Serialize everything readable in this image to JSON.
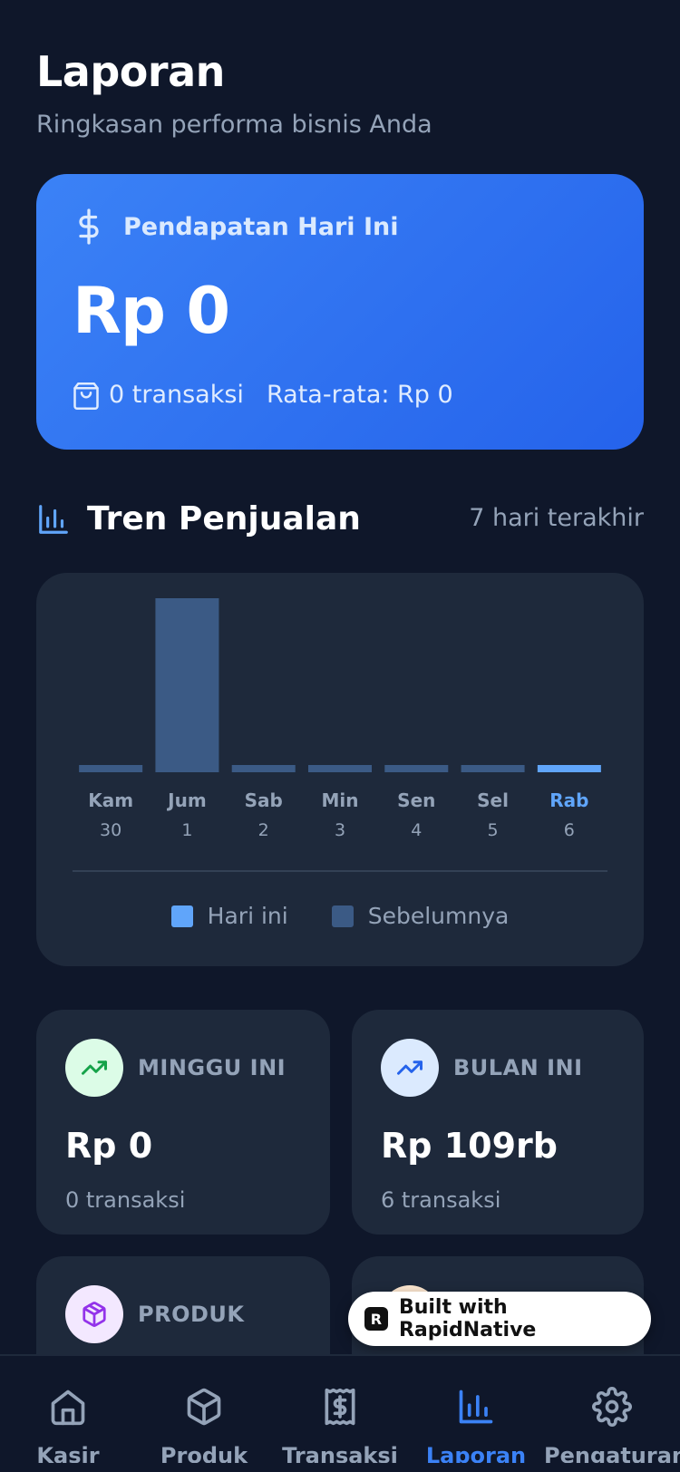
{
  "header": {
    "title": "Laporan",
    "subtitle": "Ringkasan performa bisnis Anda"
  },
  "revenue_card": {
    "label": "Pendapatan Hari Ini",
    "amount": "Rp 0",
    "transactions": "0 transaksi",
    "average": "Rata-rata: Rp 0",
    "icon": "dollar-icon",
    "tx_icon": "shopping-bag-icon"
  },
  "trend": {
    "title": "Tren Penjualan",
    "range": "7 hari terakhir",
    "icon": "bar-chart-icon",
    "legend": {
      "today": "Hari ini",
      "previous": "Sebelumnya"
    }
  },
  "chart_data": {
    "type": "bar",
    "categories": [
      "Kam",
      "Jum",
      "Sab",
      "Min",
      "Sen",
      "Sel",
      "Rab"
    ],
    "dates": [
      "30",
      "1",
      "2",
      "3",
      "4",
      "5",
      "6"
    ],
    "values": [
      0,
      109,
      0,
      0,
      0,
      0,
      0
    ],
    "highlight_index": 6,
    "colors": {
      "today": "#60a5fa",
      "previous": "#3b5a85"
    },
    "grid": false,
    "legend_placement": "bottom"
  },
  "stats": [
    {
      "label": "MINGGU INI",
      "value": "Rp 0",
      "sub": "0 transaksi",
      "icon": "trending-up-icon",
      "icon_bg": "#dcfce7",
      "icon_color": "#16a34a"
    },
    {
      "label": "BULAN INI",
      "value": "Rp 109rb",
      "sub": "6 transaksi",
      "icon": "trending-up-icon",
      "icon_bg": "#dbeafe",
      "icon_color": "#2563eb"
    },
    {
      "label": "PRODUK",
      "icon": "package-icon",
      "icon_bg": "#f3e8ff",
      "icon_color": "#9333ea"
    }
  ],
  "badge": {
    "text": "Built with RapidNative"
  },
  "nav": {
    "items": [
      {
        "label": "Kasir",
        "icon": "home-icon"
      },
      {
        "label": "Produk",
        "icon": "package-icon"
      },
      {
        "label": "Transaksi",
        "icon": "receipt-icon"
      },
      {
        "label": "Laporan",
        "icon": "bar-chart-icon",
        "active": true
      },
      {
        "label": "Pengaturan",
        "icon": "gear-icon"
      }
    ]
  }
}
